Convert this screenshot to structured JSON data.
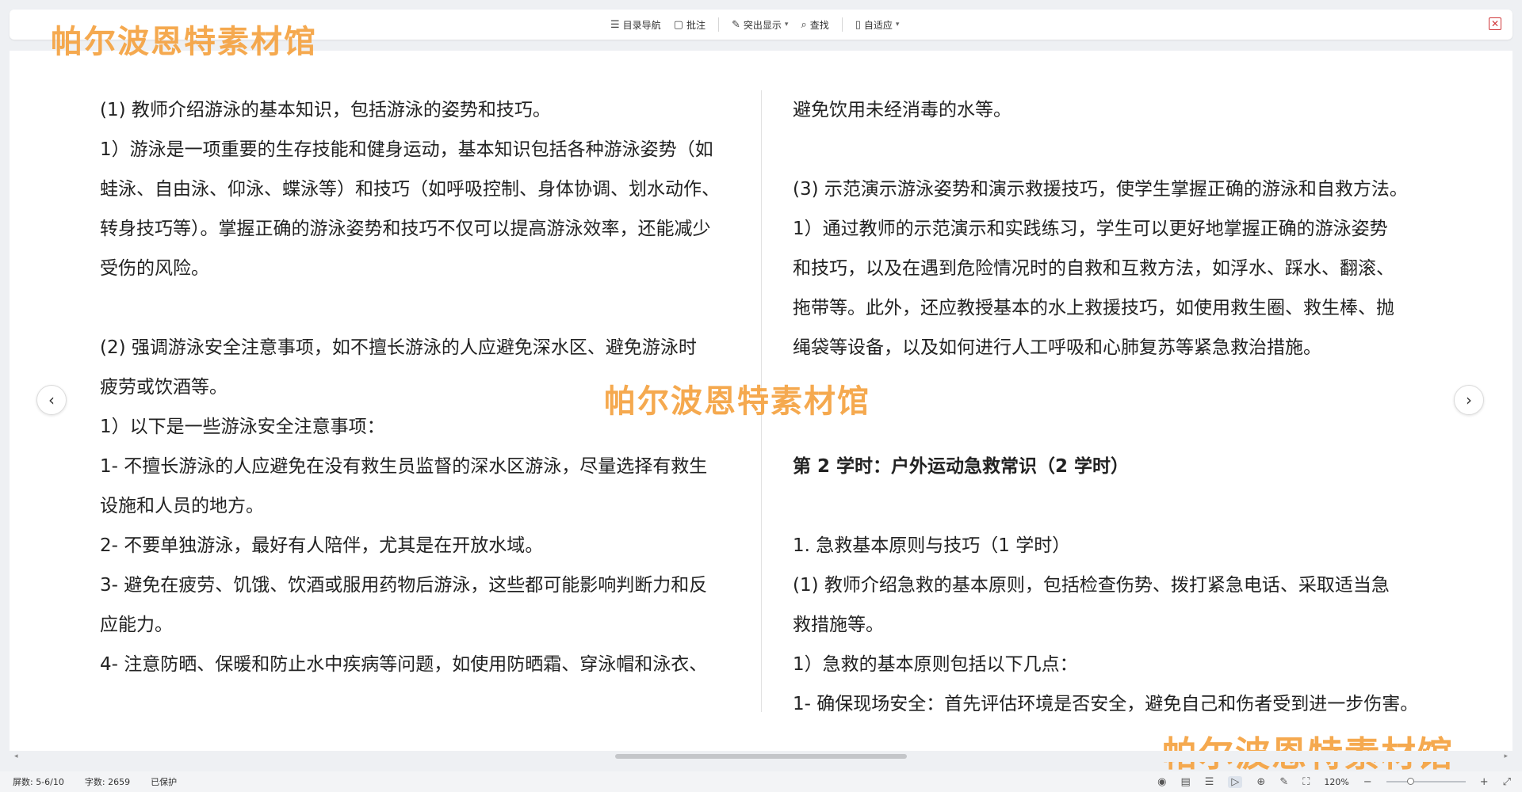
{
  "toolbar": {
    "toc_label": "目录导航",
    "annotate_label": "批注",
    "highlight_label": "突出显示",
    "find_label": "查找",
    "fit_label": "自适应",
    "close_icon": "close-icon"
  },
  "watermark": "帕尔波恩特素材馆",
  "document": {
    "left_lines": [
      "(1) 教师介绍游泳的基本知识，包括游泳的姿势和技巧。",
      "1）游泳是一项重要的生存技能和健身运动，基本知识包括各种游泳姿势（如",
      "蛙泳、自由泳、仰泳、蝶泳等）和技巧（如呼吸控制、身体协调、划水动作、",
      "转身技巧等）。掌握正确的游泳姿势和技巧不仅可以提高游泳效率，还能减少",
      "受伤的风险。",
      "",
      "(2) 强调游泳安全注意事项，如不擅长游泳的人应避免深水区、避免游泳时",
      "疲劳或饮酒等。",
      "1）以下是一些游泳安全注意事项：",
      "1- 不擅长游泳的人应避免在没有救生员监督的深水区游泳，尽量选择有救生",
      "设施和人员的地方。",
      "2- 不要单独游泳，最好有人陪伴，尤其是在开放水域。",
      "3- 避免在疲劳、饥饿、饮酒或服用药物后游泳，这些都可能影响判断力和反",
      "应能力。",
      "4- 注意防晒、保暖和防止水中疾病等问题，如使用防晒霜、穿泳帽和泳衣、"
    ],
    "right_lines": [
      "避免饮用未经消毒的水等。",
      "",
      "(3) 示范演示游泳姿势和演示救援技巧，使学生掌握正确的游泳和自救方法。",
      "1）通过教师的示范演示和实践练习，学生可以更好地掌握正确的游泳姿势",
      "和技巧，以及在遇到危险情况时的自救和互救方法，如浮水、踩水、翻滚、",
      "拖带等。此外，还应教授基本的水上救援技巧，如使用救生圈、救生棒、抛",
      "绳袋等设备，以及如何进行人工呼吸和心肺复苏等紧急救治措施。",
      "",
      "",
      "第 2 学时：户外运动急救常识（2 学时）",
      "",
      "1. 急救基本原则与技巧（1 学时）",
      "(1) 教师介绍急救的基本原则，包括检查伤势、拨打紧急电话、采取适当急",
      "救措施等。",
      "1）急救的基本原则包括以下几点：",
      "1- 确保现场安全：首先评估环境是否安全，避免自己和伤者受到进一步伤害。"
    ],
    "right_bold_index": 9
  },
  "status": {
    "page": "屏数: 5-6/10",
    "words": "字数: 2659",
    "protection": "已保护",
    "zoom": "120%",
    "zoom_fraction": 0.3
  },
  "colors": {
    "watermark": "#f5a241",
    "close": "#d0383b"
  }
}
